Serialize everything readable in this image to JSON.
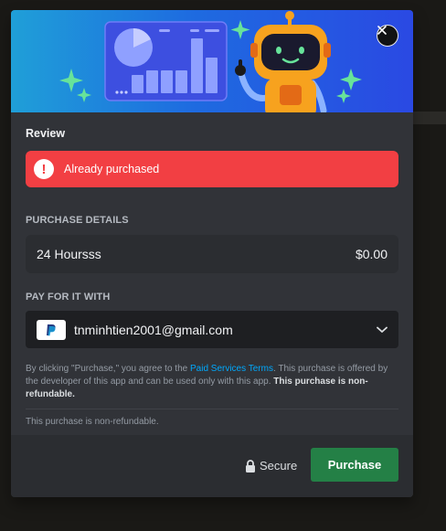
{
  "review": {
    "title": "Review"
  },
  "alert": {
    "icon": "exclamation-icon",
    "symbol": "!",
    "text": "Already purchased"
  },
  "purchase_details": {
    "label": "PURCHASE DETAILS",
    "item_name": "24 Hoursss",
    "price": "$0.00"
  },
  "payment": {
    "label": "PAY FOR IT WITH",
    "method_icon": "paypal-icon",
    "email": "tnminhtien2001@gmail.com"
  },
  "terms": {
    "prefix": "By clicking \"Purchase,\" you agree to the ",
    "link": "Paid Services Terms",
    "middle": ". This purchase is offered by the developer of this app and can be used only with this app. ",
    "bold": "This purchase is non-refundable."
  },
  "non_refundable_note": "This purchase is non-refundable.",
  "footer": {
    "secure_label": "Secure",
    "purchase_label": "Purchase"
  },
  "colors": {
    "alert": "#f23f43",
    "purchase": "#248046",
    "link": "#00a8fc",
    "modal": "#313338"
  }
}
